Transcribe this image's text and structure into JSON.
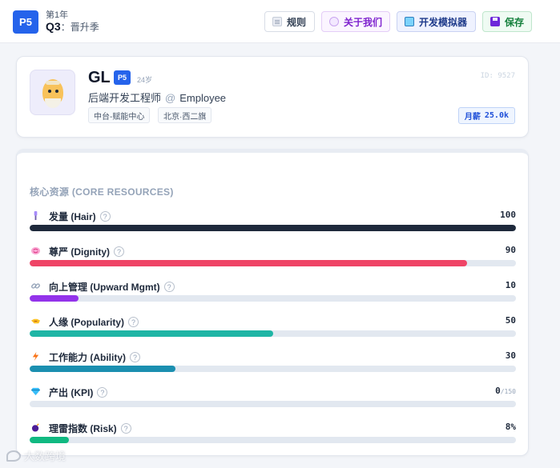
{
  "header": {
    "level_badge": "P5",
    "year": "第1年",
    "quarter": "Q3",
    "season": "：晋升季",
    "buttons": {
      "rules": "规则",
      "about": "关于我们",
      "simulator": "开发模拟器",
      "save": "保存"
    }
  },
  "profile": {
    "name": "GL",
    "level": "P5",
    "age": "24岁",
    "title": "后端开发工程师",
    "at": "@",
    "role": "Employee",
    "tags": [
      "中台-赋能中心",
      "北京·西二旗"
    ],
    "id": "ID: 9527",
    "salary_label": "月薪",
    "salary_value": "25.0k"
  },
  "resources": {
    "title": "核心资源 (CORE RESOURCES)",
    "help_glyph": "?",
    "items": [
      {
        "label": "发量 (Hair)",
        "value": "100",
        "max": "",
        "fraction": 1.0,
        "color": "#1e293b",
        "icon": "hair-brush-icon"
      },
      {
        "label": "尊严 (Dignity)",
        "value": "90",
        "max": "",
        "fraction": 0.9,
        "color": "#ef4466",
        "icon": "brain-icon"
      },
      {
        "label": "向上管理 (Upward Mgmt)",
        "value": "10",
        "max": "",
        "fraction": 0.1,
        "color": "#9333ea",
        "icon": "link-icon"
      },
      {
        "label": "人缘 (Popularity)",
        "value": "50",
        "max": "",
        "fraction": 0.5,
        "color": "#1fb5a5",
        "icon": "handshake-icon"
      },
      {
        "label": "工作能力 (Ability)",
        "value": "30",
        "max": "",
        "fraction": 0.3,
        "color": "#1b8fb0",
        "icon": "lightning-icon"
      },
      {
        "label": "产出 (KPI)",
        "value": "0",
        "max": "/150",
        "fraction": 0.0,
        "color": "#3b82f6",
        "icon": "gem-icon"
      },
      {
        "label": "理雷指数 (Risk)",
        "value": "8%",
        "max": "",
        "fraction": 0.08,
        "color": "#10b981",
        "icon": "bomb-icon"
      }
    ]
  },
  "watermark": "大数跨境"
}
